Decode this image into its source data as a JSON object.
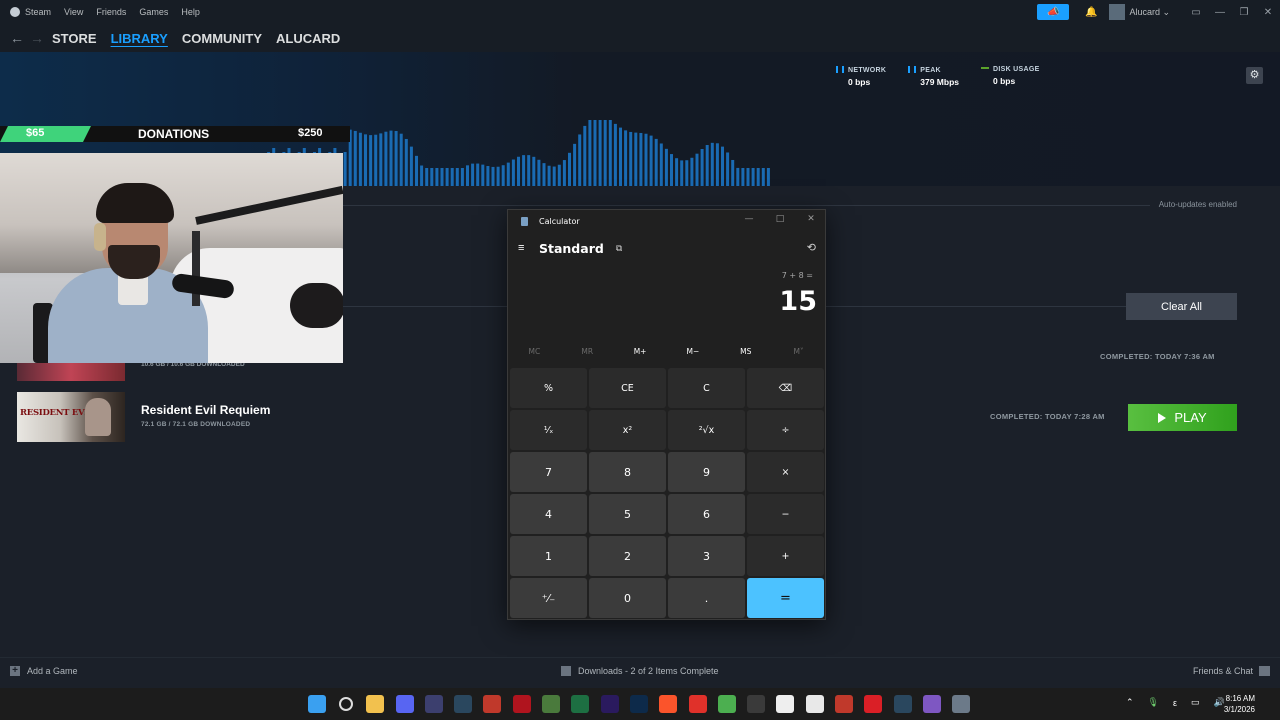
{
  "menubar": {
    "items": [
      "Steam",
      "View",
      "Friends",
      "Games",
      "Help"
    ],
    "username": "Alucard"
  },
  "nav": {
    "tabs": [
      "STORE",
      "LIBRARY",
      "COMMUNITY",
      "ALUCARD"
    ],
    "active": "LIBRARY"
  },
  "stats": [
    {
      "label": "NETWORK",
      "value": "0 bps",
      "color": "#1a9fff"
    },
    {
      "label": "PEAK",
      "value": "379 Mbps",
      "color": "#1a9fff"
    },
    {
      "label": "DISK USAGE",
      "value": "0 bps",
      "color": "#5ba32b"
    }
  ],
  "downloads": {
    "auto_updates": "Auto-updates enabled",
    "clear_all": "Clear All",
    "prev_item": {
      "size": "10.6 GB / 10.6 GB DOWNLOADED",
      "completed": "COMPLETED: TODAY 7:36 AM"
    },
    "item": {
      "title": "Resident Evil Requiem",
      "thumb_logo": "RESIDENT EVIL",
      "size": "72.1 GB / 72.1 GB DOWNLOADED",
      "completed": "COMPLETED: TODAY 7:28 AM",
      "action": "PLAY"
    }
  },
  "donations": {
    "current": "$65",
    "label": "DONATIONS",
    "goal": "$250",
    "progress_fraction": 0.26
  },
  "calculator": {
    "window_title": "Calculator",
    "mode": "Standard",
    "expression": "7 + 8 =",
    "result": "15",
    "memory": [
      "MC",
      "MR",
      "M+",
      "M−",
      "MS",
      "M˅"
    ],
    "memory_enabled": [
      false,
      false,
      true,
      true,
      true,
      false
    ],
    "keys": [
      {
        "label": "%",
        "kind": "op"
      },
      {
        "label": "CE",
        "kind": "op"
      },
      {
        "label": "C",
        "kind": "op"
      },
      {
        "label": "⌫",
        "kind": "op"
      },
      {
        "label": "¹⁄ₓ",
        "kind": "op"
      },
      {
        "label": "x²",
        "kind": "op"
      },
      {
        "label": "²√x",
        "kind": "op"
      },
      {
        "label": "÷",
        "kind": "op"
      },
      {
        "label": "7",
        "kind": "num"
      },
      {
        "label": "8",
        "kind": "num"
      },
      {
        "label": "9",
        "kind": "num"
      },
      {
        "label": "×",
        "kind": "op"
      },
      {
        "label": "4",
        "kind": "num"
      },
      {
        "label": "5",
        "kind": "num"
      },
      {
        "label": "6",
        "kind": "num"
      },
      {
        "label": "−",
        "kind": "op"
      },
      {
        "label": "1",
        "kind": "num"
      },
      {
        "label": "2",
        "kind": "num"
      },
      {
        "label": "3",
        "kind": "num"
      },
      {
        "label": "+",
        "kind": "op"
      },
      {
        "label": "⁺⁄₋",
        "kind": "num"
      },
      {
        "label": "0",
        "kind": "num"
      },
      {
        "label": ".",
        "kind": "num"
      },
      {
        "label": "=",
        "kind": "eq"
      }
    ]
  },
  "statusbar": {
    "add_game": "Add a Game",
    "downloads": "Downloads - 2 of 2 Items Complete",
    "friends": "Friends & Chat"
  },
  "taskbar": {
    "time": "8:16 AM",
    "date": "3/1/2026",
    "apps": [
      {
        "name": "start-icon",
        "color": "#3aa0f0"
      },
      {
        "name": "search-icon",
        "color": "#1c1c1c"
      },
      {
        "name": "file-explorer-icon",
        "color": "#f2c14e"
      },
      {
        "name": "discord-icon",
        "color": "#5865f2"
      },
      {
        "name": "media-player-icon",
        "color": "#3c3f6e"
      },
      {
        "name": "steam-icon",
        "color": "#2a475e"
      },
      {
        "name": "app-eu-icon",
        "color": "#c0392b"
      },
      {
        "name": "razer-icon",
        "color": "#b0141e"
      },
      {
        "name": "pixel-app-icon",
        "color": "#4a7a3c"
      },
      {
        "name": "excel-icon",
        "color": "#1d6f42"
      },
      {
        "name": "premiere-icon",
        "color": "#2a1a5e"
      },
      {
        "name": "photoshop-icon",
        "color": "#0d2a4a"
      },
      {
        "name": "brave-icon",
        "color": "#fb542b"
      },
      {
        "name": "adobe-icon",
        "color": "#e0312a"
      },
      {
        "name": "chrome-icon",
        "color": "#4caf50"
      },
      {
        "name": "obs-icon",
        "color": "#3a3a3a"
      },
      {
        "name": "capcut-icon",
        "color": "#eeeeee"
      },
      {
        "name": "messenger-icon",
        "color": "#e8e8e8"
      },
      {
        "name": "app-eu2-icon",
        "color": "#c0392b"
      },
      {
        "name": "creative-cloud-icon",
        "color": "#da1f26"
      },
      {
        "name": "steam2-icon",
        "color": "#2a475e"
      },
      {
        "name": "grid-app-icon",
        "color": "#7e57c2"
      },
      {
        "name": "calculator-icon",
        "color": "#6c7a89"
      }
    ]
  }
}
